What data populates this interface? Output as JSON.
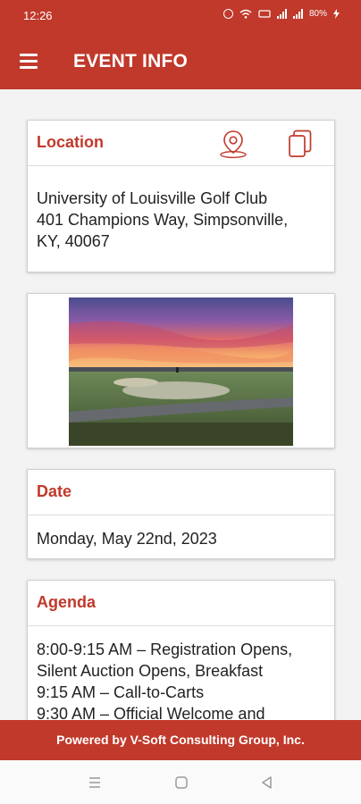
{
  "status": {
    "time": "12:26",
    "battery": "80%"
  },
  "appbar": {
    "title": "EVENT INFO",
    "menu_icon": "hamburger-menu-icon"
  },
  "location": {
    "title": "Location",
    "lines": [
      "University of Louisville Golf Club",
      "401 Champions Way, Simpsonville,",
      "KY, 40067"
    ],
    "map_icon": "map-pin-icon",
    "copy_icon": "copy-icon"
  },
  "image": {
    "caption": ""
  },
  "date": {
    "title": "Date",
    "value": "Monday, May 22nd, 2023"
  },
  "agenda": {
    "title": "Agenda",
    "lines": [
      "8:00-9:15 AM – Registration Opens,",
      "Silent Auction Opens,  Breakfast",
      "9:15 AM – Call-to-Carts",
      "9:30 AM – Official Welcome and"
    ]
  },
  "footer": {
    "text": "Powered by V-Soft Consulting Group, Inc."
  },
  "colors": {
    "brand": "#c0392b"
  }
}
